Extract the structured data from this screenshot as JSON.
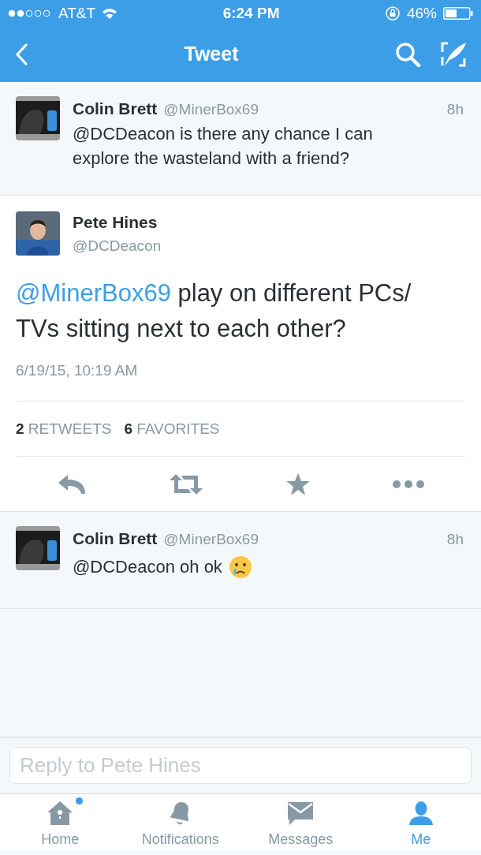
{
  "status_bar": {
    "carrier": "AT&T",
    "time": "6:24 PM",
    "battery": "46%"
  },
  "nav": {
    "title": "Tweet"
  },
  "parent_tweet": {
    "name": "Colin Brett",
    "handle": "@MinerBox69",
    "time": "8h",
    "text": "@DCDeacon is there any chance I can explore the wasteland with a friend?"
  },
  "focused_tweet": {
    "name": "Pete Hines",
    "handle": "@DCDeacon",
    "mention": "@MinerBox69",
    "text": "play on different PCs/ TVs sitting next to each other?",
    "date": "6/19/15, 10:19 AM",
    "stats": [
      {
        "count": "2",
        "label": "RETWEETS"
      },
      {
        "count": "6",
        "label": "FAVORITES"
      }
    ]
  },
  "replies": [
    {
      "name": "Colin Brett",
      "handle": "@MinerBox69",
      "time": "8h",
      "text": "@DCDeacon oh ok",
      "emoji": true
    }
  ],
  "reply_field": {
    "placeholder": "Reply to Pete Hines"
  },
  "tabs": [
    {
      "label": "Home",
      "selected": false,
      "unread": true
    },
    {
      "label": "Notifications",
      "selected": false,
      "unread": false
    },
    {
      "label": "Messages",
      "selected": false,
      "unread": false
    },
    {
      "label": "Me",
      "selected": true,
      "unread": false
    }
  ]
}
